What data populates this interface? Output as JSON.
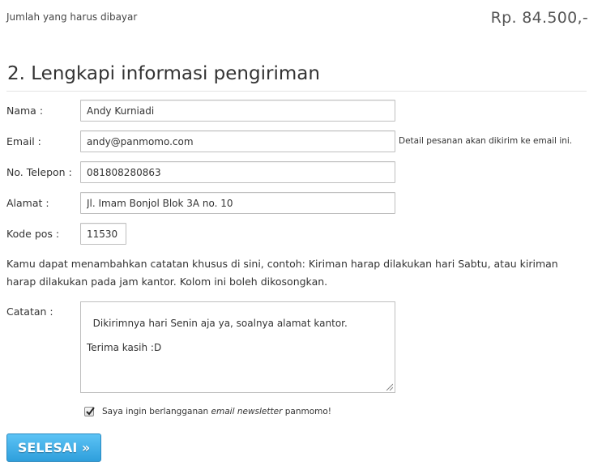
{
  "summary": {
    "total_label": "Jumlah yang harus dibayar",
    "total_amount": "Rp. 84.500,-"
  },
  "section": {
    "title": "2. Lengkapi informasi pengiriman"
  },
  "form": {
    "name": {
      "label": "Nama :",
      "value": "Andy Kurniadi"
    },
    "email": {
      "label": "Email :",
      "value": "andy@panmomo.com",
      "hint": "Detail pesanan akan dikirim ke email ini."
    },
    "phone": {
      "label": "No. Telepon :",
      "value": "081808280863"
    },
    "address": {
      "label": "Alamat :",
      "value": "Jl. Imam Bonjol Blok 3A no. 10"
    },
    "postal": {
      "label": "Kode pos :",
      "value": "11530"
    },
    "notes_intro": "Kamu dapat menambahkan catatan khusus di sini, contoh: Kiriman harap dilakukan hari Sabtu, atau kiriman harap dilakukan pada jam kantor. Kolom ini boleh dikosongkan.",
    "notes": {
      "label": "Catatan :",
      "value": "Dikirimnya hari Senin aja ya, soalnya alamat kantor.\n\nTerima kasih :D"
    },
    "newsletter": {
      "checked": true,
      "label_before": "Saya ingin berlangganan ",
      "label_emphasis": "email newsletter",
      "label_after": " panmomo!"
    },
    "submit_label": "SELESAI »"
  },
  "colors": {
    "button_top": "#5cc3f5",
    "button_bottom": "#2f9fdc",
    "field_border": "#bfbfbf"
  }
}
